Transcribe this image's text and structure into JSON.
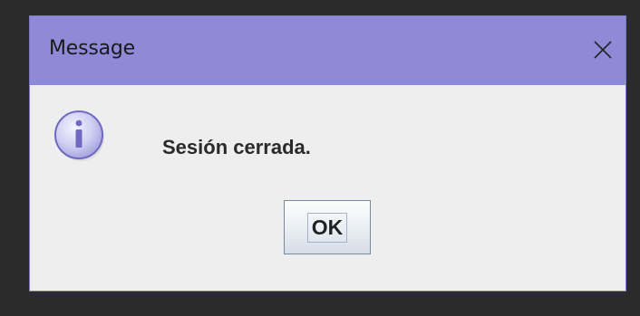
{
  "dialog": {
    "title": "Message",
    "message": "Sesión cerrada.",
    "ok_label": "OK",
    "icon": "info-icon",
    "close_icon": "close-icon"
  },
  "colors": {
    "titlebar": "#8f8ad8",
    "body": "#eeeeee",
    "icon_fill": "#c8c8f0",
    "icon_border": "#7a74c8"
  }
}
